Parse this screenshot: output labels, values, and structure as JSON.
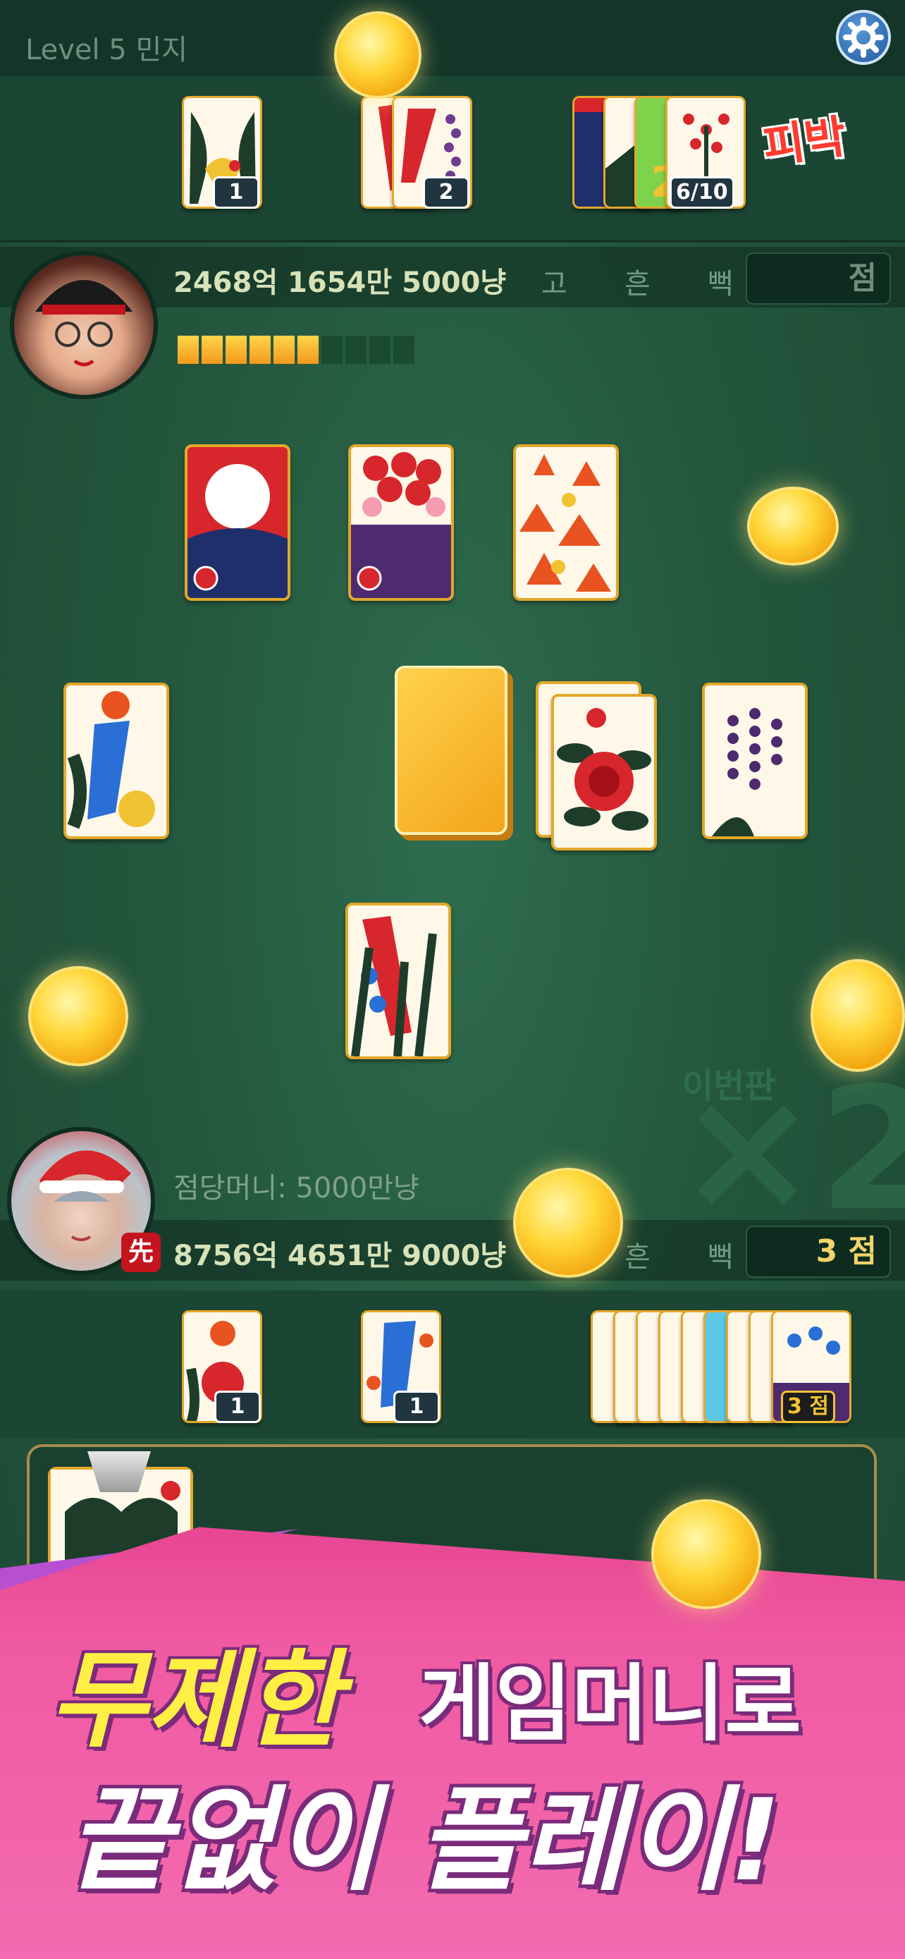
{
  "header": {
    "level_label": "Level 5 민지",
    "settings_icon": "gear-icon"
  },
  "opponent": {
    "money": "2468억 1654만 5000냥",
    "go_label": "고",
    "heun_label": "흔",
    "ppeok_label": "뻑",
    "score": "점",
    "turn_progress": {
      "filled": 6,
      "total": 10
    },
    "captured": [
      {
        "group": "gwang",
        "count": "1"
      },
      {
        "group": "tti",
        "count": "2"
      },
      {
        "group": "pi",
        "count": "6/10"
      }
    ],
    "status": "피박"
  },
  "table": {
    "deck_icon": "deck-icon"
  },
  "player": {
    "point_money": "점당머니: 5000만냥",
    "first_badge": "先",
    "money": "8756억 4651만 9000냥",
    "heun_label": "흔",
    "ppeok_label": "뻑",
    "score": "3 점",
    "captured": [
      {
        "group": "yeol",
        "count": "1"
      },
      {
        "group": "tti",
        "count": "1"
      },
      {
        "group": "pi",
        "count": "3 점"
      }
    ]
  },
  "round": {
    "label": "이번판",
    "multiplier": "×2"
  },
  "promo": {
    "line1_highlight": "무제한",
    "line1_rest": "게임머니로",
    "line2": "끝없이 플레이!"
  },
  "colors": {
    "felt": "#24573e",
    "gold": "#f5c330",
    "pink": "#f05aa2",
    "red": "#c4141d"
  }
}
